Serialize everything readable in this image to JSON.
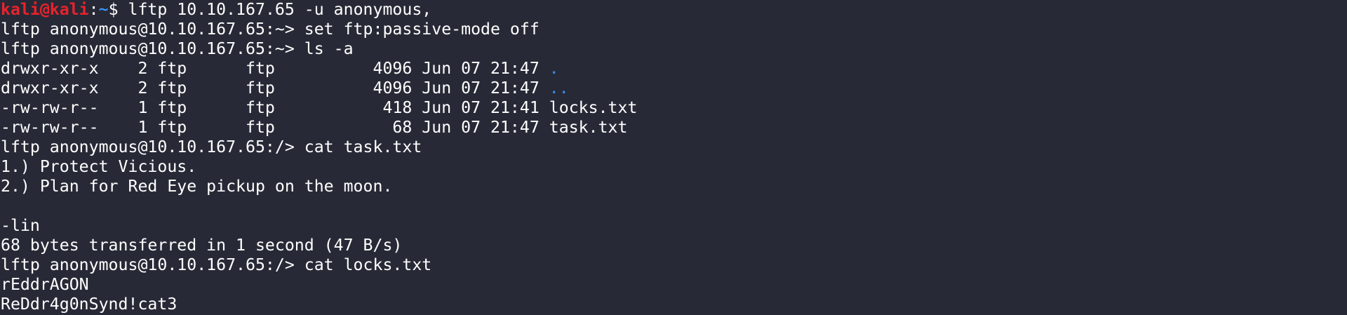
{
  "prompt": {
    "user_host": "kali@kali",
    "sep": ":",
    "path": "~",
    "symbol": "$ ",
    "command": "lftp 10.10.167.65 -u anonymous,"
  },
  "lines": {
    "l1": "lftp anonymous@10.10.167.65:~> set ftp:passive-mode off",
    "l2": "lftp anonymous@10.10.167.65:~> ls -a",
    "l7": "lftp anonymous@10.10.167.65:/> cat task.txt",
    "l8": "1.) Protect Vicious.",
    "l9": "2.) Plan for Red Eye pickup on the moon.",
    "l10": "",
    "l11": "-lin",
    "l12": "68 bytes transferred in 1 second (47 B/s)",
    "l13": "lftp anonymous@10.10.167.65:/> cat locks.txt",
    "l14": "rEddrAGON",
    "l15": "ReDdr4g0nSynd!cat3"
  },
  "listing": [
    {
      "perms": "drwxr-xr-x",
      "info": "    2 ftp      ftp          4096 Jun 07 21:47 ",
      "name": ".",
      "is_dir": true
    },
    {
      "perms": "drwxr-xr-x",
      "info": "    2 ftp      ftp          4096 Jun 07 21:47 ",
      "name": "..",
      "is_dir": true
    },
    {
      "perms": "-rw-rw-r--",
      "info": "    1 ftp      ftp           418 Jun 07 21:41 ",
      "name": "locks.txt",
      "is_dir": false
    },
    {
      "perms": "-rw-rw-r--",
      "info": "    1 ftp      ftp            68 Jun 07 21:47 ",
      "name": "task.txt",
      "is_dir": false
    }
  ],
  "colors": {
    "background": "#272a36",
    "text": "#ffffff",
    "prompt_user": "#e8222d",
    "prompt_path": "#3a8ff3",
    "directory": "#3a8ff3"
  }
}
